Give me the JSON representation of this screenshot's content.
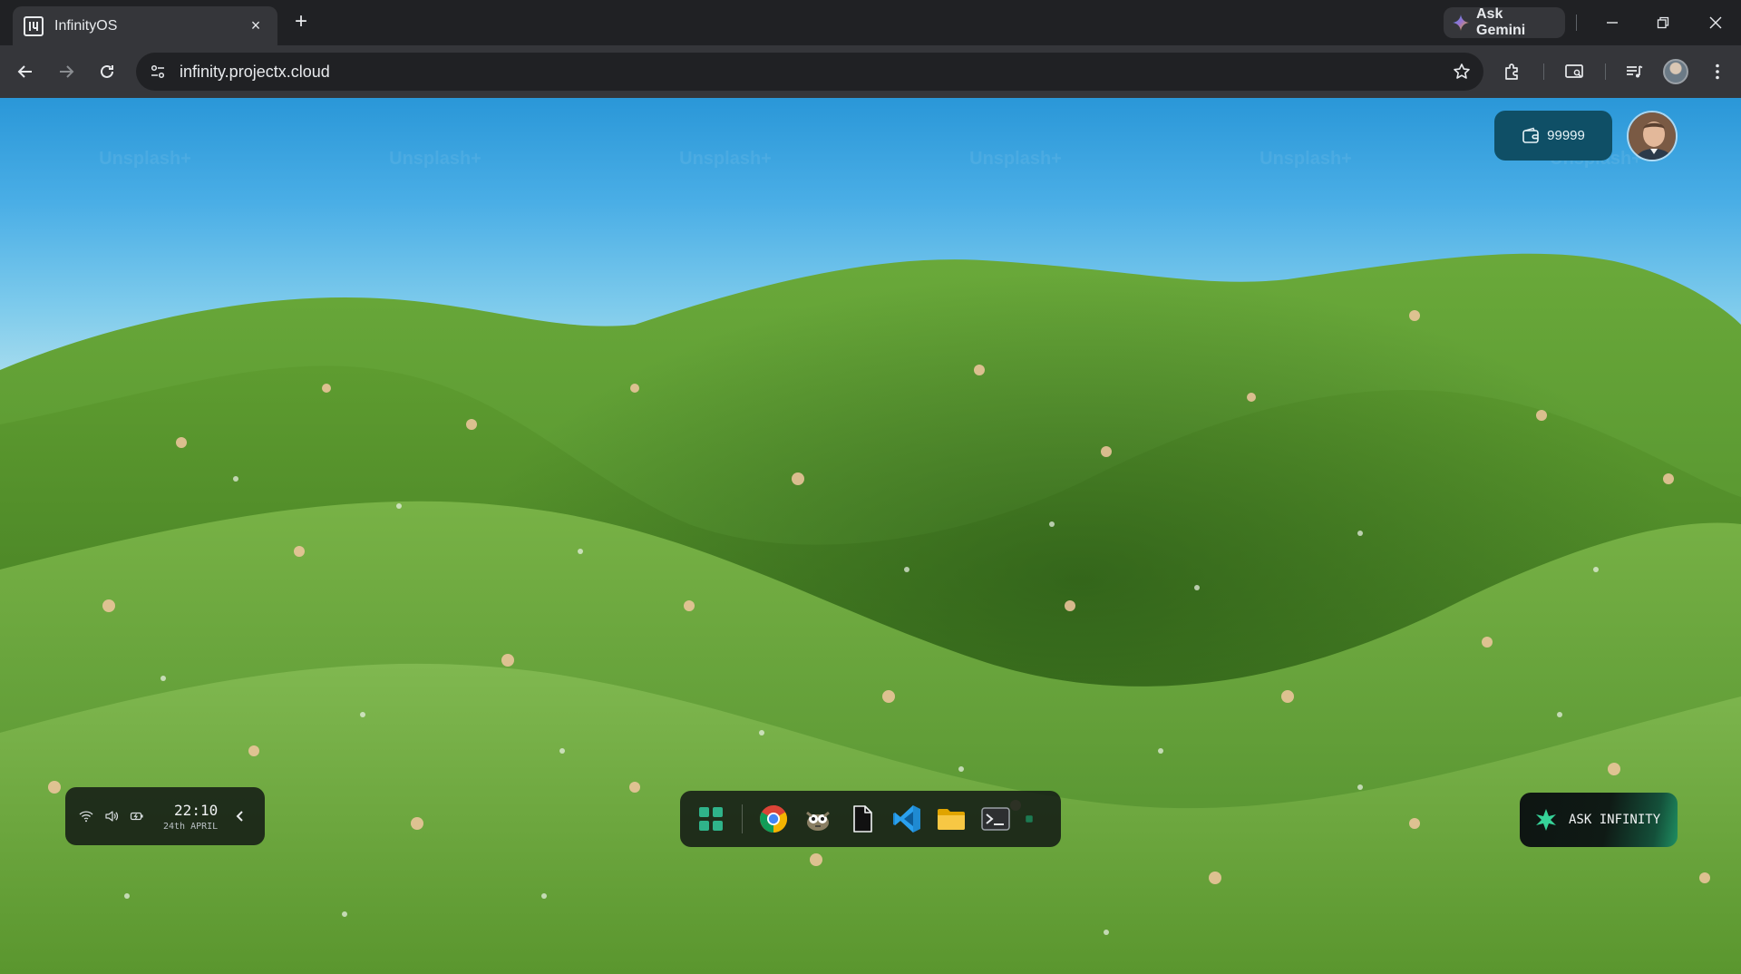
{
  "browser": {
    "tab_title": "InfinityOS",
    "tab_close_icon": "×",
    "new_tab_icon": "+",
    "gemini_label": "Ask Gemini",
    "url": "infinity.projectx.cloud"
  },
  "desktop": {
    "credits": "99999",
    "watermark": "Unsplash+"
  },
  "system_tray": {
    "time": "22:10",
    "date": "24th APRIL",
    "icons": [
      "wifi-icon",
      "volume-icon",
      "battery-icon"
    ]
  },
  "dock": {
    "apps": [
      "app-launcher-icon",
      "chrome-icon",
      "gimp-icon",
      "file-icon",
      "vscode-icon",
      "folder-icon",
      "terminal-icon",
      "indicator-icon"
    ]
  },
  "assistant": {
    "label": "ASK INFINITY"
  },
  "colors": {
    "accent_teal": "#0f4f66",
    "assistant_green": "#1f8f62",
    "chrome_bg": "#202124"
  }
}
